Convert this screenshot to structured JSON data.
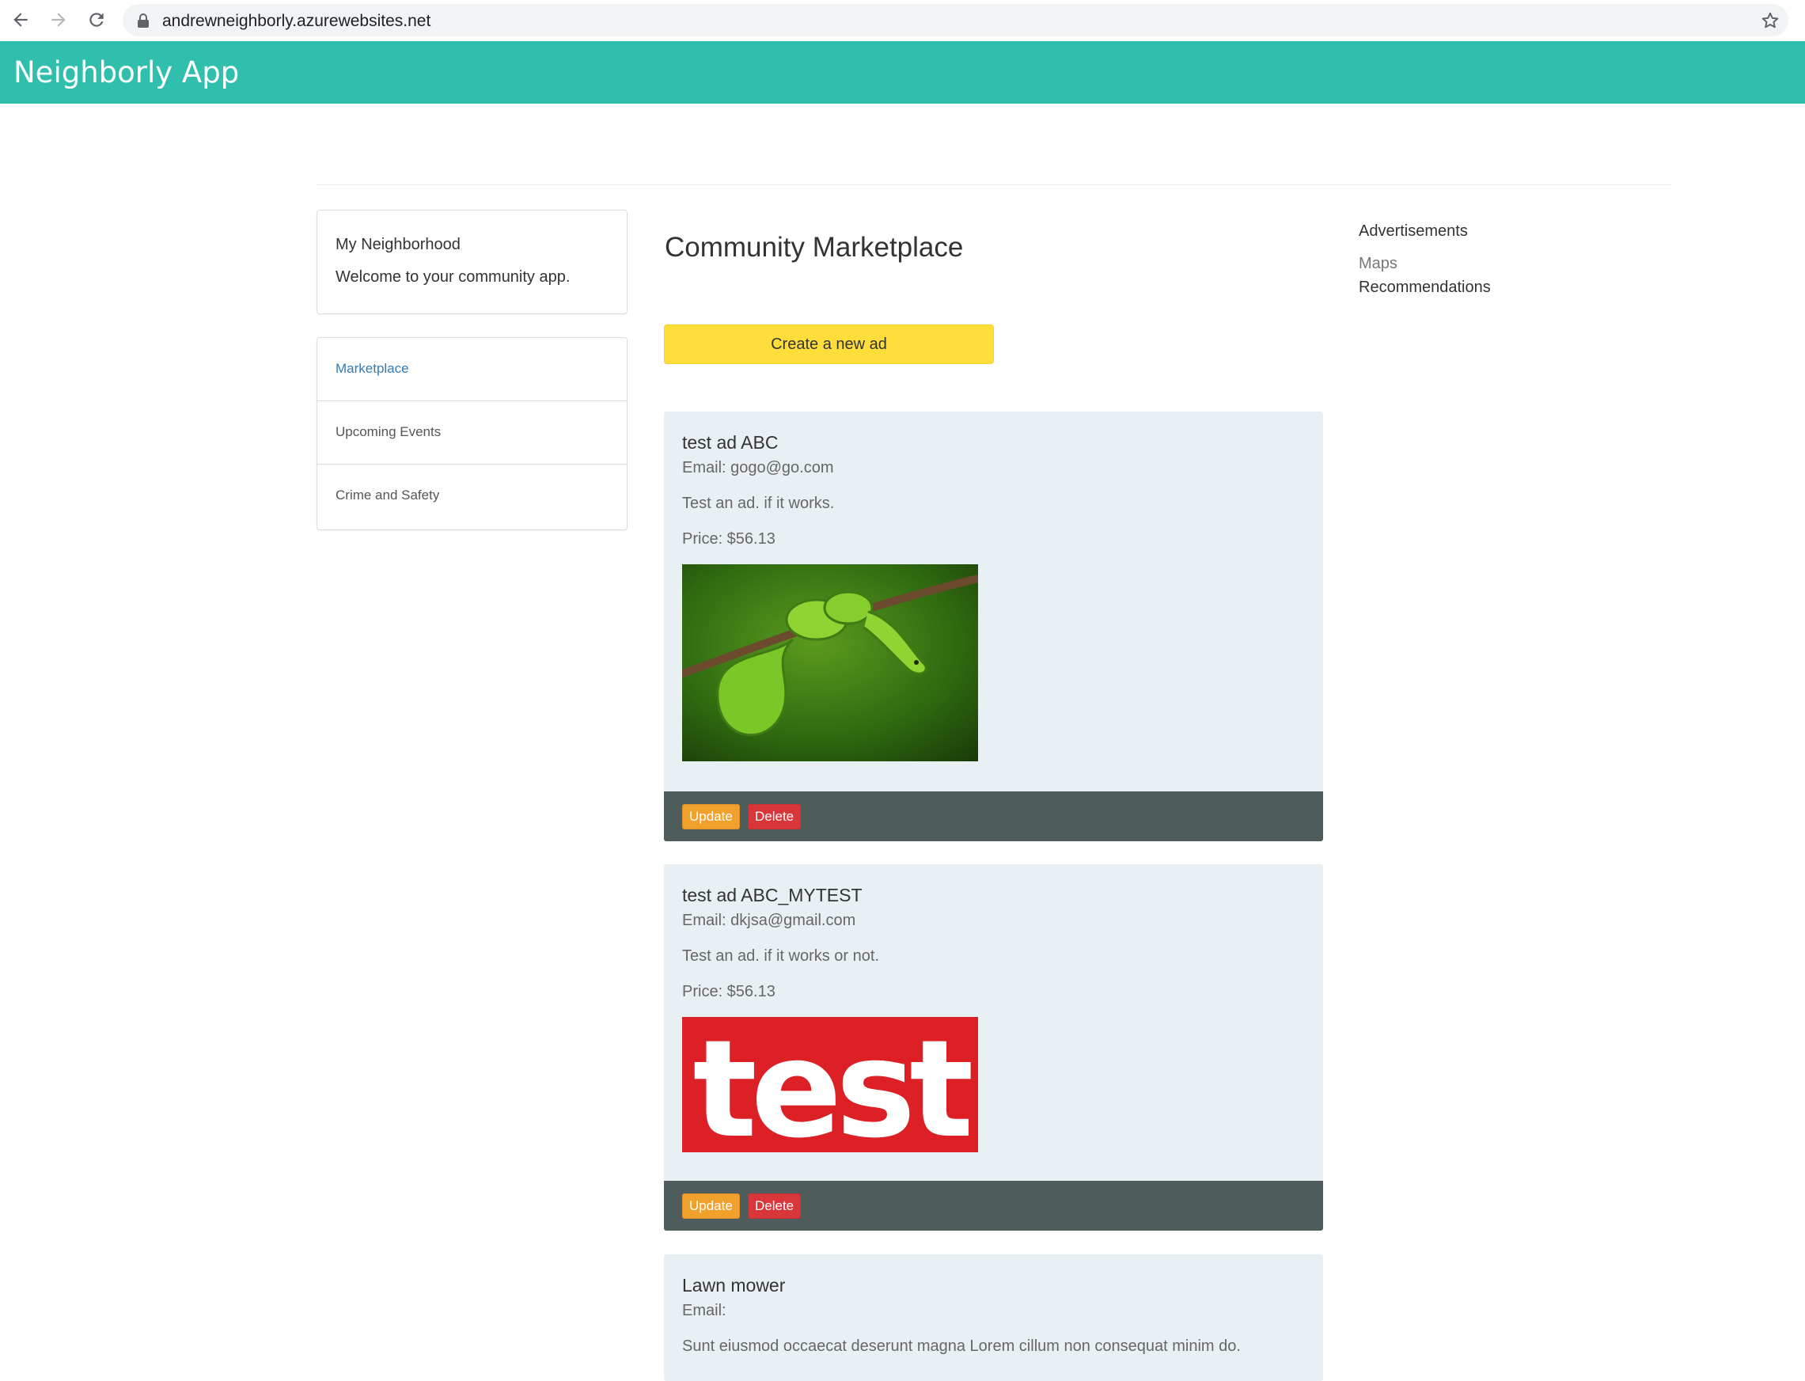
{
  "browser": {
    "url": "andrewneighborly.azurewebsites.net"
  },
  "app": {
    "brand": "Neighborly App",
    "header_color": "#2fbfac"
  },
  "left": {
    "intro": {
      "title": "My Neighborhood",
      "text": "Welcome to your community app."
    },
    "nav": [
      {
        "label": "Marketplace",
        "active": true
      },
      {
        "label": "Upcoming Events",
        "active": false
      },
      {
        "label": "Crime and Safety",
        "active": false
      }
    ]
  },
  "main": {
    "title": "Community Marketplace",
    "create_button": "Create a new ad",
    "ads": [
      {
        "title": "test ad ABC",
        "email": "Email: gogo@go.com",
        "description": "Test an ad. if it works.",
        "price": "Price: $56.13",
        "image": "green-snake-on-branch",
        "update_label": "Update",
        "delete_label": "Delete"
      },
      {
        "title": "test ad ABC_MYTEST",
        "email": "Email: dkjsa@gmail.com",
        "description": "Test an ad. if it works or not.",
        "price": "Price: $56.13",
        "image": "red-test-logo",
        "image_text": "test",
        "update_label": "Update",
        "delete_label": "Delete"
      },
      {
        "title": "Lawn mower",
        "email": "Email:",
        "description": "Sunt eiusmod occaecat deserunt magna Lorem cillum non consequat minim do."
      }
    ]
  },
  "right": {
    "heading": "Advertisements",
    "links": [
      "Maps",
      "Recommendations"
    ]
  }
}
